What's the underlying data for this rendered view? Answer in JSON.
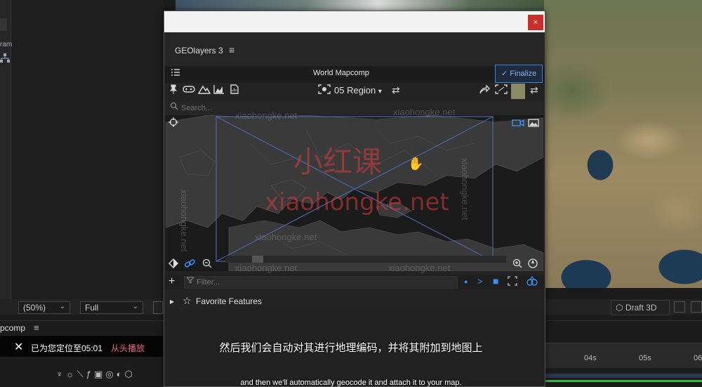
{
  "plugin": {
    "app_title": "GEOlayers 3",
    "comp_name": "World Mapcomp",
    "finalize_label": "Finalize",
    "region_label": "05 Region",
    "search_placeholder": "Search...",
    "filter_placeholder": "Filter...",
    "favorites_label": "Favorite Features",
    "close_glyph": "×",
    "swatch_color": "#8a8a66",
    "accent_color": "#3b8ff2"
  },
  "ae": {
    "zoom": "(50%)",
    "resolution": "Full",
    "draft_label": "Draft 3D",
    "comp_tab": "pcomp",
    "left_label": "ram",
    "ticks": [
      "04s",
      "05s",
      "06"
    ]
  },
  "toast": {
    "message": "已为您定位至05:01",
    "link": "从头播放"
  },
  "subtitle": {
    "zh": "然后我们会自动对其进行地理编码，并将其附加到地图上",
    "en": "and then we'll automatically geocode it and attach it to your map."
  },
  "watermark": {
    "brand_zh": "小红课",
    "brand_url": "xiaohongke.net"
  },
  "icons": {
    "pin": "pin-icon",
    "gamepad": "gamepad-icon",
    "mountain": "mountain-icon",
    "chart": "chart-icon",
    "document": "document-icon",
    "swap": "swap-icon",
    "share": "share-icon",
    "frame": "frame-icon",
    "crosshair": "crosshair-icon",
    "camera": "camera-icon",
    "image": "image-icon",
    "diamond": "diamond-icon",
    "link": "link-icon",
    "zoom-out": "zoom-out-icon",
    "zoom-in": "zoom-in-icon",
    "compass": "compass-icon"
  }
}
